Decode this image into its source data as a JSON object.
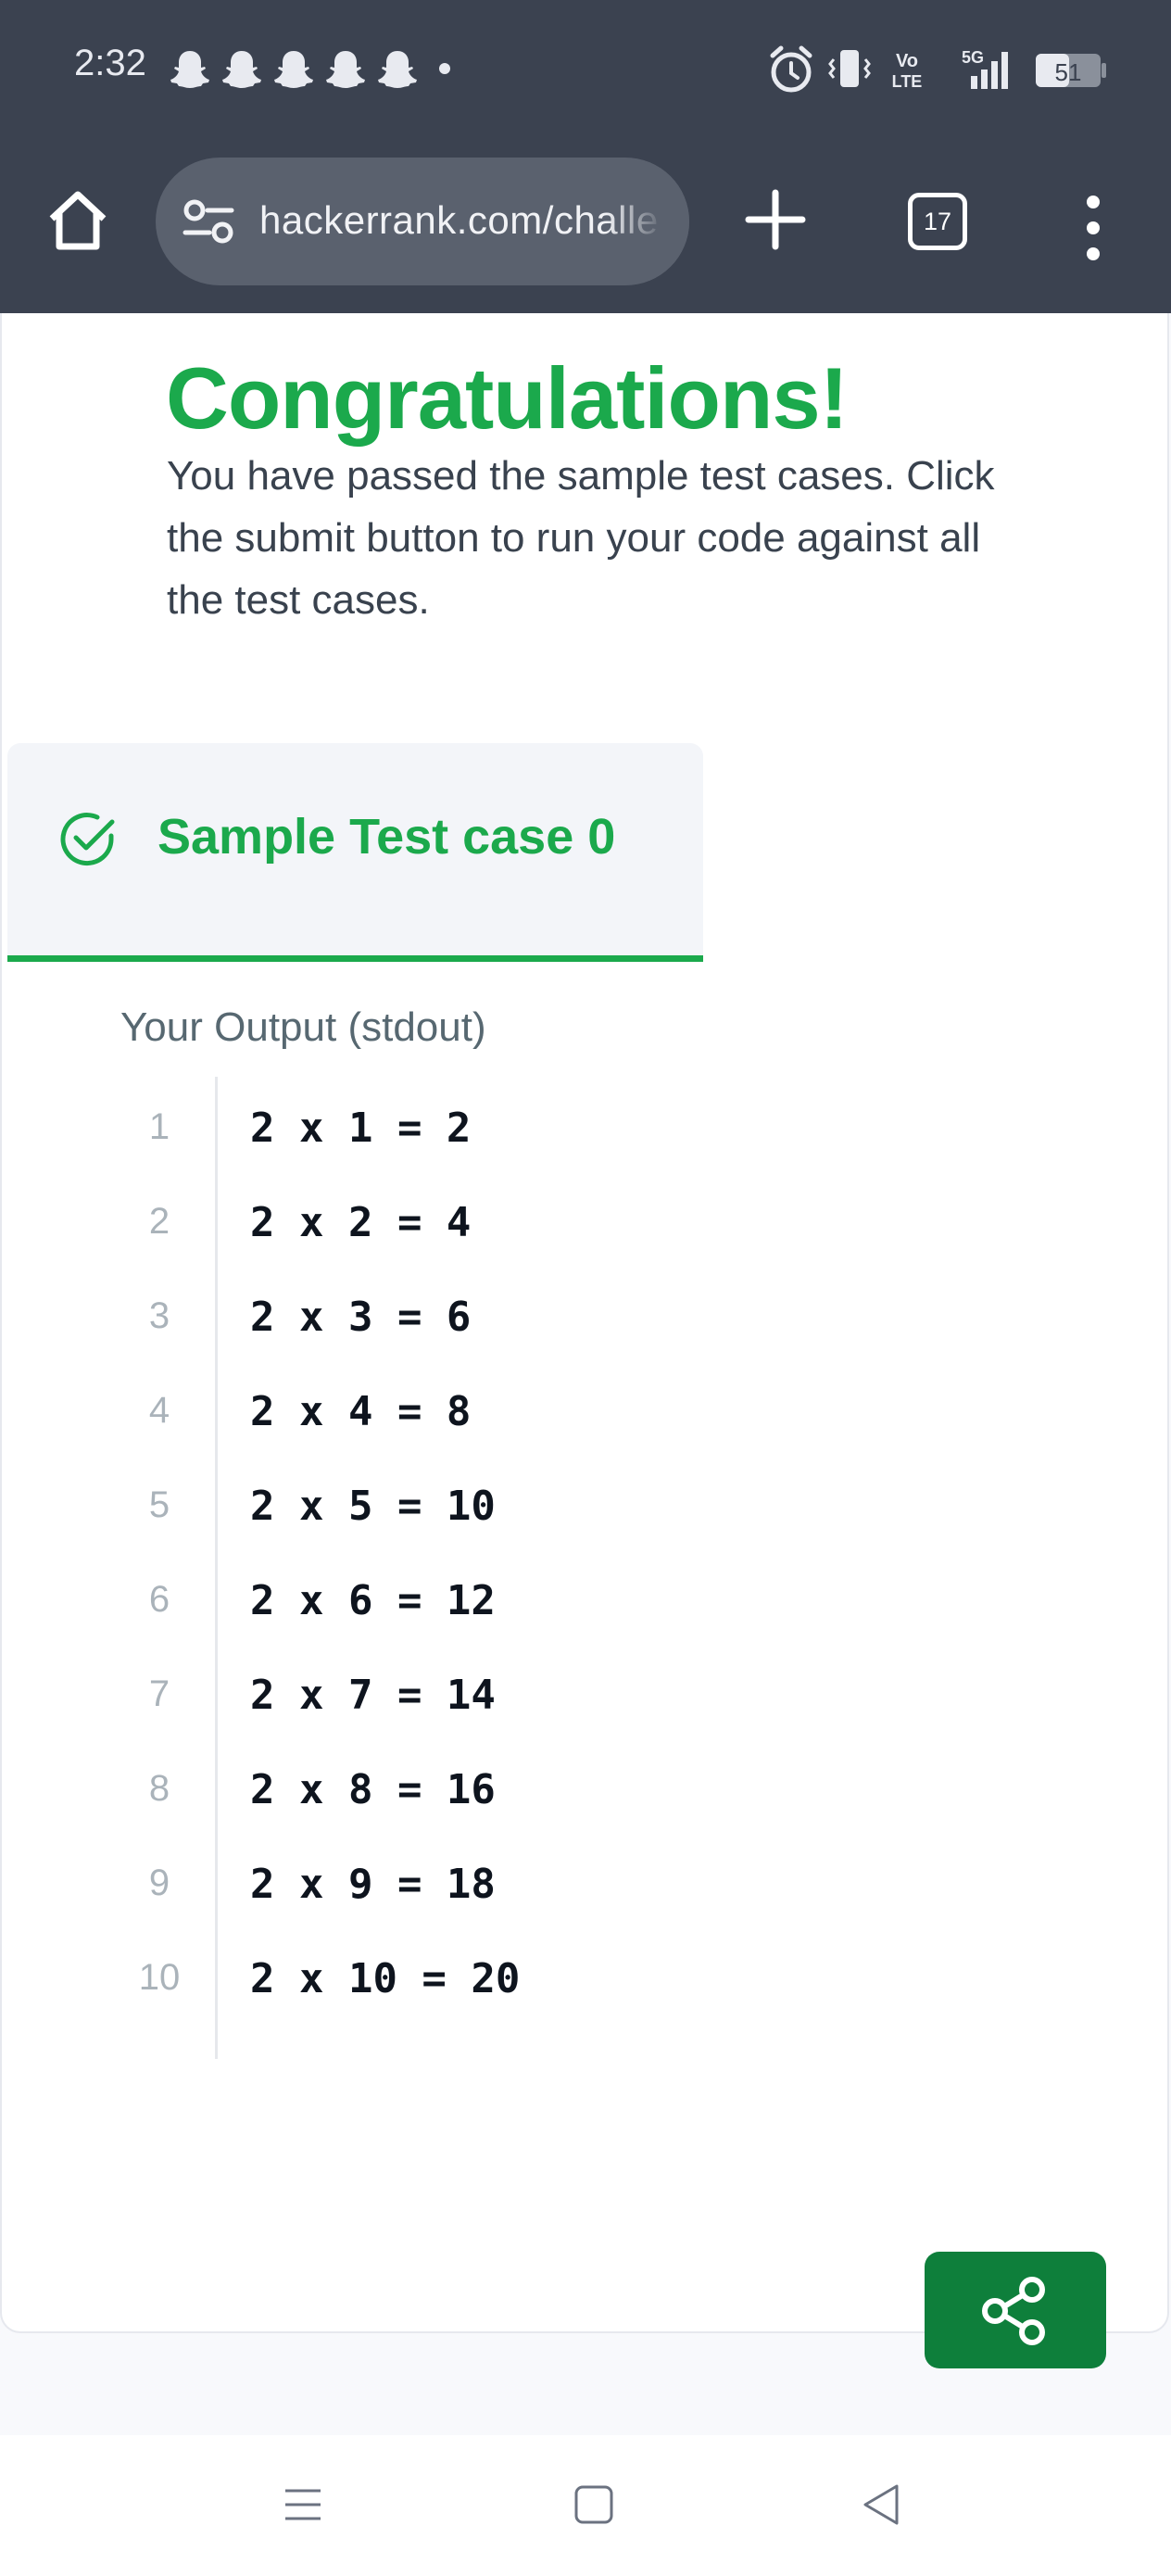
{
  "status_bar": {
    "time": "2:32",
    "network": "5G",
    "volte": "Vo\nLTE",
    "battery": "51",
    "icons": [
      "snapchat-icon",
      "snapchat-icon",
      "snapchat-icon",
      "snapchat-icon",
      "snapchat-icon",
      "alarm-icon",
      "vibrate-icon",
      "volte-icon",
      "signal-icon",
      "battery-icon"
    ]
  },
  "browser": {
    "url": "hackerrank.com/challe",
    "tab_count": "17",
    "icons": [
      "home-icon",
      "site-settings-icon",
      "plus-icon",
      "tab-switcher-icon",
      "more-vert-icon"
    ]
  },
  "result": {
    "title": "Congratulations!",
    "message": "You have passed the sample test cases. Click the submit button to run your code against all the test cases."
  },
  "test_case": {
    "label": "Sample Test case 0",
    "output_label": "Your Output (stdout)",
    "lines": [
      {
        "num": "1",
        "text": "2 x 1 = 2"
      },
      {
        "num": "2",
        "text": "2 x 2 = 4"
      },
      {
        "num": "3",
        "text": "2 x 3 = 6"
      },
      {
        "num": "4",
        "text": "2 x 4 = 8"
      },
      {
        "num": "5",
        "text": "2 x 5 = 10"
      },
      {
        "num": "6",
        "text": "2 x 6 = 12"
      },
      {
        "num": "7",
        "text": "2 x 7 = 14"
      },
      {
        "num": "8",
        "text": "2 x 8 = 16"
      },
      {
        "num": "9",
        "text": "2 x 9 = 18"
      },
      {
        "num": "10",
        "text": "2 x 10 = 20"
      }
    ]
  },
  "colors": {
    "success_green": "#1ba94c",
    "share_button": "#0e7f3b",
    "system_bar": "#3b4250"
  }
}
